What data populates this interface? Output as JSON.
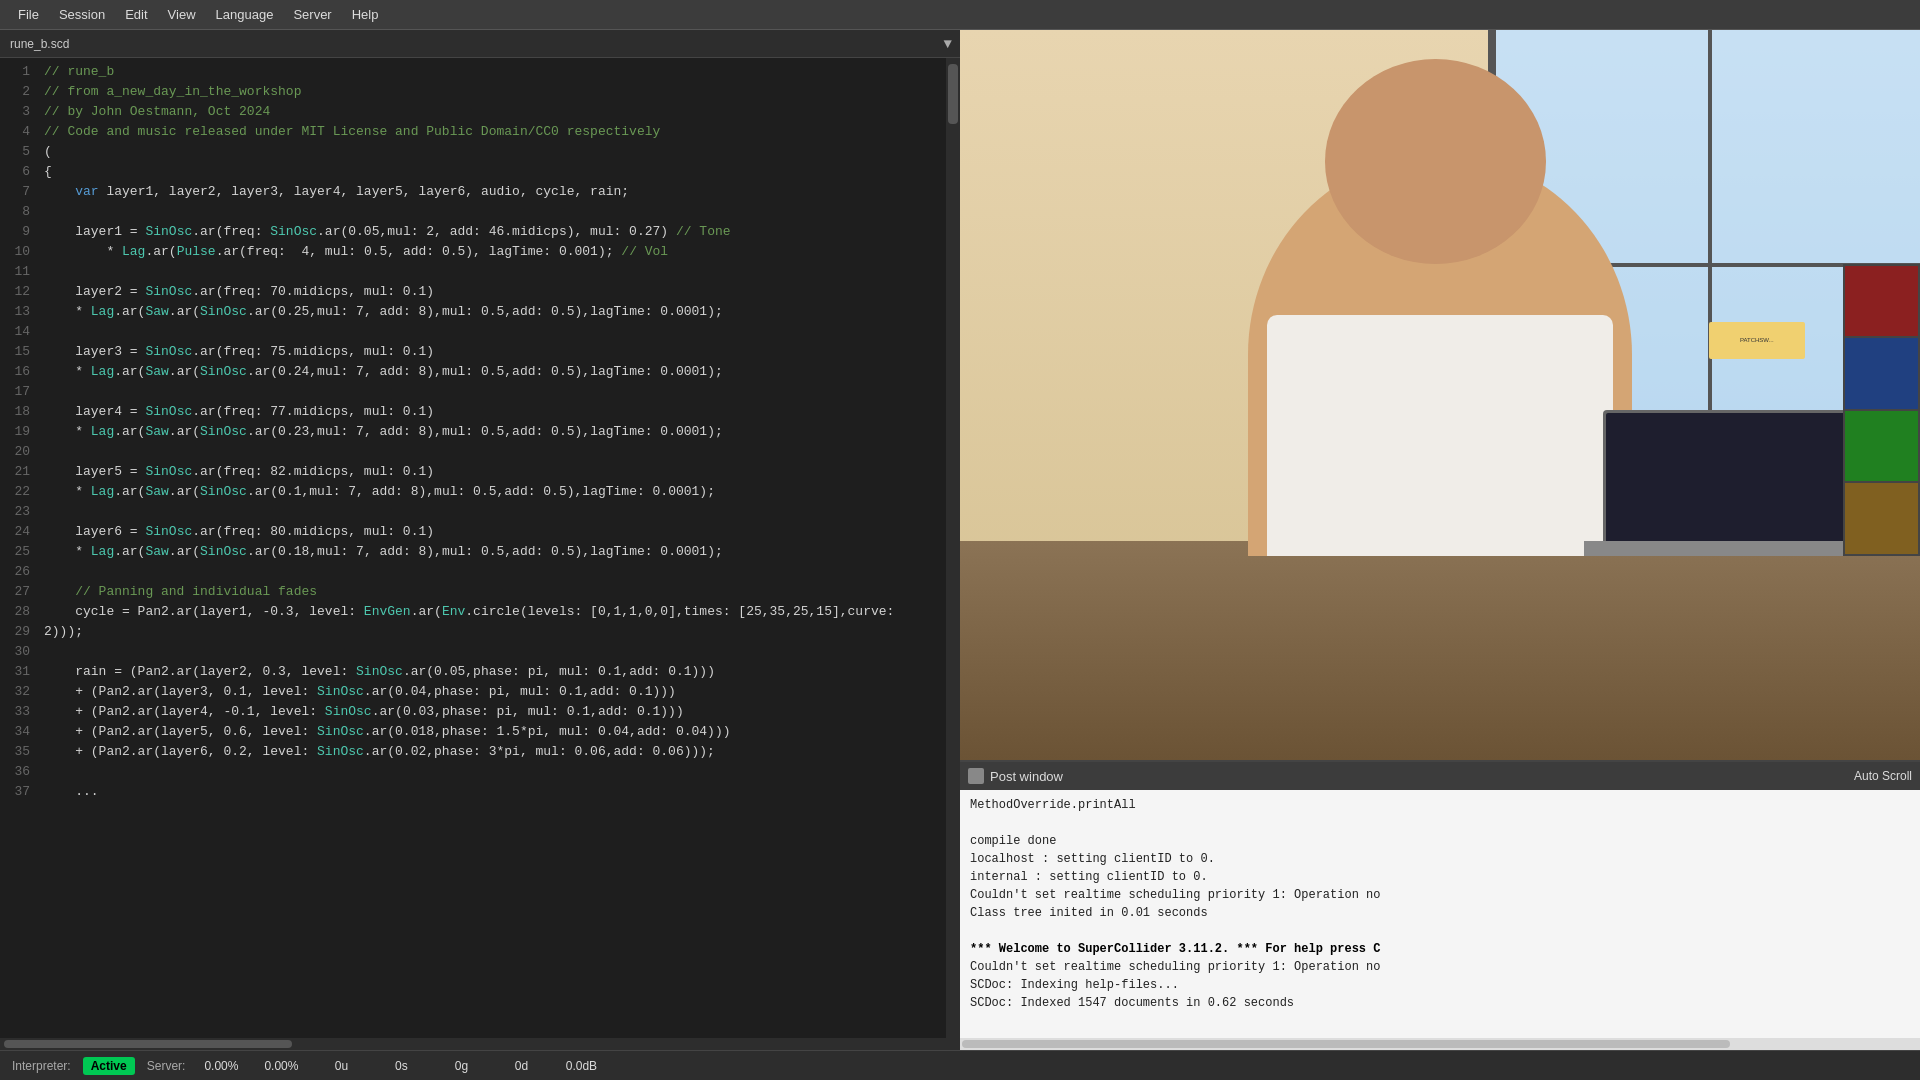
{
  "menubar": {
    "items": [
      "File",
      "Session",
      "Edit",
      "View",
      "Language",
      "Server",
      "Help"
    ]
  },
  "tab": {
    "label": "rune_b.scd",
    "arrow": "▼"
  },
  "editor": {
    "lines": [
      {
        "num": 1,
        "content": [
          {
            "t": "comment",
            "v": "// rune_b"
          }
        ]
      },
      {
        "num": 2,
        "content": [
          {
            "t": "comment",
            "v": "// from a_new_day_in_the_workshop"
          }
        ]
      },
      {
        "num": 3,
        "content": [
          {
            "t": "comment",
            "v": "// by John Oestmann, Oct 2024"
          }
        ]
      },
      {
        "num": 4,
        "content": [
          {
            "t": "comment",
            "v": "// Code and music released under MIT License and Public Domain/CC0 respectively"
          }
        ]
      },
      {
        "num": 5,
        "content": [
          {
            "t": "plain",
            "v": "("
          }
        ]
      },
      {
        "num": 6,
        "content": [
          {
            "t": "plain",
            "v": "{"
          }
        ]
      },
      {
        "num": 7,
        "content": [
          {
            "t": "plain",
            "v": "\t"
          },
          {
            "t": "kw",
            "v": "var"
          },
          {
            "t": "plain",
            "v": " layer1, layer2, layer3, layer4, layer5, layer6, audio, cycle, rain;"
          }
        ]
      },
      {
        "num": 8,
        "content": []
      },
      {
        "num": 9,
        "content": [
          {
            "t": "plain",
            "v": "\tlayer1 = "
          },
          {
            "t": "obj",
            "v": "SinOsc"
          },
          {
            "t": "plain",
            "v": ".ar(freq: "
          },
          {
            "t": "obj",
            "v": "SinOsc"
          },
          {
            "t": "plain",
            "v": ".ar(0.05,mul: 2, add: 46.midicps), mul: 0.27) "
          },
          {
            "t": "comment",
            "v": "// Tone"
          }
        ]
      },
      {
        "num": 10,
        "content": [
          {
            "t": "plain",
            "v": "\t\t* "
          },
          {
            "t": "obj",
            "v": "Lag"
          },
          {
            "t": "plain",
            "v": ".ar("
          },
          {
            "t": "obj",
            "v": "Pulse"
          },
          {
            "t": "plain",
            "v": ".ar(freq:  4, mul: 0.5, add: 0.5), lagTime: 0.001); "
          },
          {
            "t": "comment",
            "v": "// Vol"
          }
        ]
      },
      {
        "num": 11,
        "content": []
      },
      {
        "num": 12,
        "content": [
          {
            "t": "plain",
            "v": "\tlayer2 = "
          },
          {
            "t": "obj",
            "v": "SinOsc"
          },
          {
            "t": "plain",
            "v": ".ar(freq: 70.midicps, mul: 0.1)"
          }
        ]
      },
      {
        "num": 13,
        "content": [
          {
            "t": "plain",
            "v": "\t* "
          },
          {
            "t": "obj",
            "v": "Lag"
          },
          {
            "t": "plain",
            "v": ".ar("
          },
          {
            "t": "obj",
            "v": "Saw"
          },
          {
            "t": "plain",
            "v": ".ar("
          },
          {
            "t": "obj",
            "v": "SinOsc"
          },
          {
            "t": "plain",
            "v": ".ar(0.25,mul: 7, add: 8),mul: 0.5,add: 0.5),lagTime: 0.0001);"
          }
        ]
      },
      {
        "num": 14,
        "content": []
      },
      {
        "num": 15,
        "content": [
          {
            "t": "plain",
            "v": "\tlayer3 = "
          },
          {
            "t": "obj",
            "v": "SinOsc"
          },
          {
            "t": "plain",
            "v": ".ar(freq: 75.midicps, mul: 0.1)"
          }
        ]
      },
      {
        "num": 16,
        "content": [
          {
            "t": "plain",
            "v": "\t* "
          },
          {
            "t": "obj",
            "v": "Lag"
          },
          {
            "t": "plain",
            "v": ".ar("
          },
          {
            "t": "obj",
            "v": "Saw"
          },
          {
            "t": "plain",
            "v": ".ar("
          },
          {
            "t": "obj",
            "v": "SinOsc"
          },
          {
            "t": "plain",
            "v": ".ar(0.24,mul: 7, add: 8),mul: 0.5,add: 0.5),lagTime: 0.0001);"
          }
        ]
      },
      {
        "num": 17,
        "content": []
      },
      {
        "num": 18,
        "content": [
          {
            "t": "plain",
            "v": "\tlayer4 = "
          },
          {
            "t": "obj",
            "v": "SinOsc"
          },
          {
            "t": "plain",
            "v": ".ar(freq: 77.midicps, mul: 0.1)"
          }
        ]
      },
      {
        "num": 19,
        "content": [
          {
            "t": "plain",
            "v": "\t* "
          },
          {
            "t": "obj",
            "v": "Lag"
          },
          {
            "t": "plain",
            "v": ".ar("
          },
          {
            "t": "obj",
            "v": "Saw"
          },
          {
            "t": "plain",
            "v": ".ar("
          },
          {
            "t": "obj",
            "v": "SinOsc"
          },
          {
            "t": "plain",
            "v": ".ar(0.23,mul: 7, add: 8),mul: 0.5,add: 0.5),lagTime: 0.0001);"
          }
        ]
      },
      {
        "num": 20,
        "content": []
      },
      {
        "num": 21,
        "content": [
          {
            "t": "plain",
            "v": "\tlayer5 = "
          },
          {
            "t": "obj",
            "v": "SinOsc"
          },
          {
            "t": "plain",
            "v": ".ar(freq: 82.midicps, mul: 0.1)"
          }
        ]
      },
      {
        "num": 22,
        "content": [
          {
            "t": "plain",
            "v": "\t* "
          },
          {
            "t": "obj",
            "v": "Lag"
          },
          {
            "t": "plain",
            "v": ".ar("
          },
          {
            "t": "obj",
            "v": "Saw"
          },
          {
            "t": "plain",
            "v": ".ar("
          },
          {
            "t": "obj",
            "v": "SinOsc"
          },
          {
            "t": "plain",
            "v": ".ar(0.1,mul: 7, add: 8),mul: 0.5,add: 0.5),lagTime: 0.0001);"
          }
        ]
      },
      {
        "num": 23,
        "content": []
      },
      {
        "num": 24,
        "content": [
          {
            "t": "plain",
            "v": "\tlayer6 = "
          },
          {
            "t": "obj",
            "v": "SinOsc"
          },
          {
            "t": "plain",
            "v": ".ar(freq: 80.midicps, mul: 0.1)"
          }
        ]
      },
      {
        "num": 25,
        "content": [
          {
            "t": "plain",
            "v": "\t* "
          },
          {
            "t": "obj",
            "v": "Lag"
          },
          {
            "t": "plain",
            "v": ".ar("
          },
          {
            "t": "obj",
            "v": "Saw"
          },
          {
            "t": "plain",
            "v": ".ar("
          },
          {
            "t": "obj",
            "v": "SinOsc"
          },
          {
            "t": "plain",
            "v": ".ar(0.18,mul: 7, add: 8),mul: 0.5,add: 0.5),lagTime: 0.0001);"
          }
        ]
      },
      {
        "num": 26,
        "content": []
      },
      {
        "num": 27,
        "content": [
          {
            "t": "comment",
            "v": "\t// Panning and individual fades"
          }
        ]
      },
      {
        "num": 28,
        "content": [
          {
            "t": "plain",
            "v": "\tcycle = Pan2.ar(layer1, -0.3, level: "
          },
          {
            "t": "obj",
            "v": "EnvGen"
          },
          {
            "t": "plain",
            "v": ".ar("
          },
          {
            "t": "obj",
            "v": "Env"
          },
          {
            "t": "plain",
            "v": ".circle(levels: [0,1,1,0,0],times: [25,35,25,15],curve:"
          }
        ]
      },
      {
        "num": 29,
        "content": [
          {
            "t": "plain",
            "v": "2)));"
          }
        ]
      },
      {
        "num": 30,
        "content": []
      },
      {
        "num": 31,
        "content": [
          {
            "t": "plain",
            "v": "\train = (Pan2.ar(layer2, 0.3, level: "
          },
          {
            "t": "obj",
            "v": "SinOsc"
          },
          {
            "t": "plain",
            "v": ".ar(0.05,"
          },
          {
            "t": "plain",
            "v": "phase"
          },
          {
            "t": "plain",
            "v": ": pi, mul: 0.1,add: 0.1)))"
          }
        ]
      },
      {
        "num": 32,
        "content": [
          {
            "t": "plain",
            "v": "\t+ (Pan2.ar(layer3, 0.1, level: "
          },
          {
            "t": "obj",
            "v": "SinOsc"
          },
          {
            "t": "plain",
            "v": ".ar(0.04,phase: pi, mul: 0.1,add: 0.1)))"
          }
        ]
      },
      {
        "num": 33,
        "content": [
          {
            "t": "plain",
            "v": "\t+ (Pan2.ar(layer4, -0.1, level: "
          },
          {
            "t": "obj",
            "v": "SinOsc"
          },
          {
            "t": "plain",
            "v": ".ar(0.03,phase: pi, mul: 0.1,add: 0.1)))"
          }
        ]
      },
      {
        "num": 34,
        "content": [
          {
            "t": "plain",
            "v": "\t+ (Pan2.ar(layer5, 0.6, level: "
          },
          {
            "t": "obj",
            "v": "SinOsc"
          },
          {
            "t": "plain",
            "v": ".ar(0.018,phase: 1.5*pi, mul: 0.04,add: 0.04)))"
          }
        ]
      },
      {
        "num": 35,
        "content": [
          {
            "t": "plain",
            "v": "\t+ (Pan2.ar(layer6, 0.2, level: "
          },
          {
            "t": "obj",
            "v": "SinOsc"
          },
          {
            "t": "plain",
            "v": ".ar(0.02,phase: 3*pi, mul: 0.06,add: 0.06)));"
          }
        ]
      },
      {
        "num": 36,
        "content": []
      },
      {
        "num": 37,
        "content": [
          {
            "t": "plain",
            "v": "\t..."
          }
        ]
      }
    ]
  },
  "post_window": {
    "title": "Post window",
    "auto_scroll": "Auto Scroll",
    "lines": [
      "MethodOverride.printAll",
      "",
      "compile done",
      "localhost : setting clientID to 0.",
      "internal : setting clientID to 0.",
      "Couldn't set realtime scheduling priority 1: Operation no",
      "Class tree inited in 0.01 seconds",
      "",
      "*** Welcome to SuperCollider 3.11.2. *** For help press C",
      "Couldn't set realtime scheduling priority 1: Operation no",
      "SCDoc: Indexing help-files...",
      "SCDoc: Indexed 1547 documents in 0.62 seconds"
    ]
  },
  "status_bar": {
    "interpreter_label": "Interpreter:",
    "active_badge": "Active",
    "server_label": "Server:",
    "cpu1": "0.00%",
    "cpu2": "0.00%",
    "u": "0u",
    "s": "0s",
    "g": "0g",
    "d": "0d",
    "db": "0.0dB"
  }
}
